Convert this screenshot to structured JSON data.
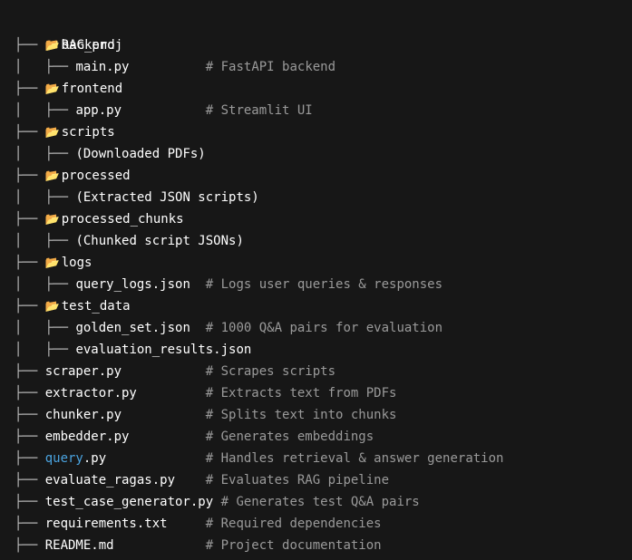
{
  "icons": {
    "folder_closed": "📁",
    "folder_open": "📂",
    "folder_closed_name": "folder-icon",
    "folder_open_name": "folder-open-icon"
  },
  "colors": {
    "background": "#171717",
    "text": "#ffffff",
    "comment": "#9a9a9a",
    "highlight": "#4aa3df"
  },
  "tree": {
    "root": {
      "icon": "📁",
      "name": "RAG_proj"
    },
    "lines": [
      {
        "prefix": "├── ",
        "icon": "📂",
        "name": "backend",
        "pad": "",
        "comment": ""
      },
      {
        "prefix": "│   ├── ",
        "icon": "",
        "name": "main.py",
        "pad": "          ",
        "comment": "# FastAPI backend"
      },
      {
        "prefix": "├── ",
        "icon": "📂",
        "name": "frontend",
        "pad": "",
        "comment": ""
      },
      {
        "prefix": "│   ├── ",
        "icon": "",
        "name": "app.py",
        "pad": "           ",
        "comment": "# Streamlit UI"
      },
      {
        "prefix": "├── ",
        "icon": "📂",
        "name": "scripts",
        "pad": "",
        "comment": ""
      },
      {
        "prefix": "│   ├── ",
        "icon": "",
        "name": "(Downloaded PDFs)",
        "pad": "",
        "comment": ""
      },
      {
        "prefix": "├── ",
        "icon": "📂",
        "name": "processed",
        "pad": "",
        "comment": ""
      },
      {
        "prefix": "│   ├── ",
        "icon": "",
        "name": "(Extracted JSON scripts)",
        "pad": "",
        "comment": ""
      },
      {
        "prefix": "├── ",
        "icon": "📂",
        "name": "processed_chunks",
        "pad": "",
        "comment": ""
      },
      {
        "prefix": "│   ├── ",
        "icon": "",
        "name": "(Chunked script JSONs)",
        "pad": "",
        "comment": ""
      },
      {
        "prefix": "├── ",
        "icon": "📂",
        "name": "logs",
        "pad": "",
        "comment": ""
      },
      {
        "prefix": "│   ├── ",
        "icon": "",
        "name": "query_logs.json",
        "pad": "  ",
        "comment": "# Logs user queries & responses"
      },
      {
        "prefix": "├── ",
        "icon": "📂",
        "name": "test_data",
        "pad": "",
        "comment": ""
      },
      {
        "prefix": "│   ├── ",
        "icon": "",
        "name": "golden_set.json",
        "pad": "  ",
        "comment": "# 1000 Q&A pairs for evaluation"
      },
      {
        "prefix": "│   ├── ",
        "icon": "",
        "name": "evaluation_results.json",
        "pad": "",
        "comment": ""
      },
      {
        "prefix": "├── ",
        "icon": "",
        "name": "scraper.py",
        "pad": "           ",
        "comment": "# Scrapes scripts"
      },
      {
        "prefix": "├── ",
        "icon": "",
        "name": "extractor.py",
        "pad": "         ",
        "comment": "# Extracts text from PDFs"
      },
      {
        "prefix": "├── ",
        "icon": "",
        "name": "chunker.py",
        "pad": "           ",
        "comment": "# Splits text into chunks"
      },
      {
        "prefix": "├── ",
        "icon": "",
        "name": "embedder.py",
        "pad": "          ",
        "comment": "# Generates embeddings"
      },
      {
        "prefix": "├── ",
        "icon": "",
        "name_hl": "query",
        "name": ".py",
        "pad": "             ",
        "comment": "# Handles retrieval & answer generation"
      },
      {
        "prefix": "├── ",
        "icon": "",
        "name": "evaluate_ragas.py",
        "pad": "    ",
        "comment": "# Evaluates RAG pipeline"
      },
      {
        "prefix": "├── ",
        "icon": "",
        "name": "test_case_generator.py",
        "pad": " ",
        "comment": "# Generates test Q&A pairs"
      },
      {
        "prefix": "├── ",
        "icon": "",
        "name": "requirements.txt",
        "pad": "     ",
        "comment": "# Required dependencies"
      },
      {
        "prefix": "├── ",
        "icon": "",
        "name": "README.md",
        "pad": "            ",
        "comment": "# Project documentation"
      }
    ]
  }
}
